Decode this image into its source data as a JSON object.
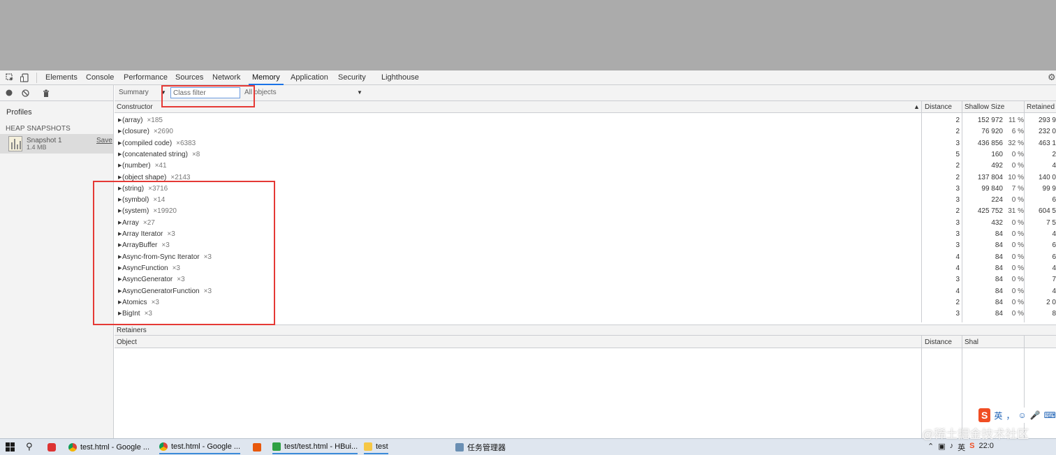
{
  "devtools": {
    "tabs": [
      "Elements",
      "Console",
      "Performance",
      "Sources",
      "Network",
      "Memory",
      "Application",
      "Security",
      "Lighthouse"
    ],
    "active_tab": "Memory",
    "icons": [
      "inspect-icon",
      "device-toggle-icon",
      "settings-gear-icon"
    ]
  },
  "left_panel": {
    "toolbar_icons": [
      "record-icon",
      "clear-icon",
      "trash-icon"
    ],
    "profiles_label": "Profiles",
    "heap_snapshots_label": "HEAP SNAPSHOTS",
    "snapshot": {
      "name": "Snapshot 1",
      "size": "1.4 MB",
      "save_label": "Save"
    }
  },
  "toolbar": {
    "view": "Summary",
    "class_filter_placeholder": "Class filter",
    "objects_filter": "All objects"
  },
  "table": {
    "headers": {
      "constructor": "Constructor",
      "distance": "Distance",
      "shallow": "Shallow Size",
      "retained": "Retained"
    },
    "rows": [
      {
        "name": "(array)",
        "count": "×185",
        "distance": "2",
        "shallow": "152 972",
        "shallow_pct": "11 %",
        "retained": "293 9"
      },
      {
        "name": "(closure)",
        "count": "×2690",
        "distance": "2",
        "shallow": "76 920",
        "shallow_pct": "6 %",
        "retained": "232 0"
      },
      {
        "name": "(compiled code)",
        "count": "×6383",
        "distance": "3",
        "shallow": "436 856",
        "shallow_pct": "32 %",
        "retained": "463 1"
      },
      {
        "name": "(concatenated string)",
        "count": "×8",
        "distance": "5",
        "shallow": "160",
        "shallow_pct": "0 %",
        "retained": "2"
      },
      {
        "name": "(number)",
        "count": "×41",
        "distance": "2",
        "shallow": "492",
        "shallow_pct": "0 %",
        "retained": "4"
      },
      {
        "name": "(object shape)",
        "count": "×2143",
        "distance": "2",
        "shallow": "137 804",
        "shallow_pct": "10 %",
        "retained": "140 0"
      },
      {
        "name": "(string)",
        "count": "×3716",
        "distance": "3",
        "shallow": "99 840",
        "shallow_pct": "7 %",
        "retained": "99 9"
      },
      {
        "name": "(symbol)",
        "count": "×14",
        "distance": "3",
        "shallow": "224",
        "shallow_pct": "0 %",
        "retained": "6"
      },
      {
        "name": "(system)",
        "count": "×19920",
        "distance": "2",
        "shallow": "425 752",
        "shallow_pct": "31 %",
        "retained": "604 5"
      },
      {
        "name": "Array",
        "count": "×27",
        "distance": "3",
        "shallow": "432",
        "shallow_pct": "0 %",
        "retained": "7 5"
      },
      {
        "name": "Array Iterator",
        "count": "×3",
        "distance": "3",
        "shallow": "84",
        "shallow_pct": "0 %",
        "retained": "4"
      },
      {
        "name": "ArrayBuffer",
        "count": "×3",
        "distance": "3",
        "shallow": "84",
        "shallow_pct": "0 %",
        "retained": "6"
      },
      {
        "name": "Async-from-Sync Iterator",
        "count": "×3",
        "distance": "4",
        "shallow": "84",
        "shallow_pct": "0 %",
        "retained": "6"
      },
      {
        "name": "AsyncFunction",
        "count": "×3",
        "distance": "4",
        "shallow": "84",
        "shallow_pct": "0 %",
        "retained": "4"
      },
      {
        "name": "AsyncGenerator",
        "count": "×3",
        "distance": "3",
        "shallow": "84",
        "shallow_pct": "0 %",
        "retained": "7"
      },
      {
        "name": "AsyncGeneratorFunction",
        "count": "×3",
        "distance": "4",
        "shallow": "84",
        "shallow_pct": "0 %",
        "retained": "4"
      },
      {
        "name": "Atomics",
        "count": "×3",
        "distance": "2",
        "shallow": "84",
        "shallow_pct": "0 %",
        "retained": "2 0"
      },
      {
        "name": "BigInt",
        "count": "×3",
        "distance": "3",
        "shallow": "84",
        "shallow_pct": "0 %",
        "retained": "8"
      }
    ]
  },
  "retainers": {
    "title": "Retainers",
    "headers": {
      "object": "Object",
      "distance": "Distance",
      "shallow": "Shal"
    }
  },
  "ime": {
    "mode": "英",
    "symbols": [
      "，",
      "☺",
      "🎤",
      "⌨"
    ]
  },
  "taskbar": {
    "apps": [
      {
        "label": "test.html - Google ...",
        "icon": "chrome-icon"
      },
      {
        "label": "test.html - Google ...",
        "icon": "chrome-icon"
      },
      {
        "label": "test/test.html - HBui...",
        "icon": "hbuilder-icon"
      },
      {
        "label": "test",
        "icon": "folder-icon"
      },
      {
        "label": "任务管理器",
        "icon": "task-manager-icon"
      }
    ],
    "ime_indicator": "英",
    "clock": "22:0"
  },
  "watermark": "@稀土掘金技术社区",
  "colors": {
    "highlight": "#e53935",
    "active_tab": "#1a73e8",
    "panel_bg": "#f3f3f3"
  }
}
